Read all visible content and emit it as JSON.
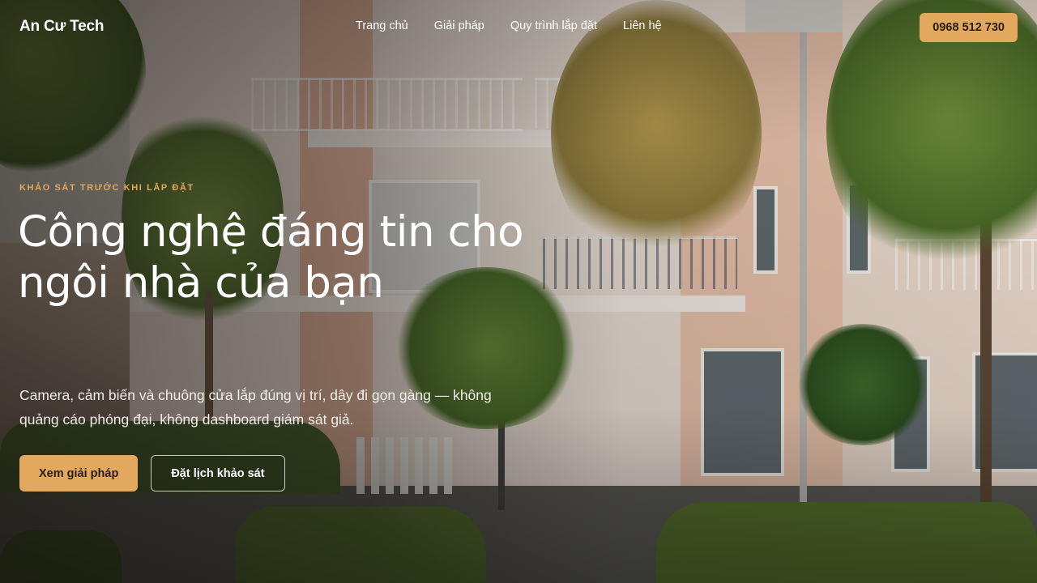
{
  "header": {
    "brand": "An Cư Tech",
    "nav": [
      {
        "label": "Trang chủ"
      },
      {
        "label": "Giải pháp"
      },
      {
        "label": "Quy trình lắp đặt"
      },
      {
        "label": "Liên hệ"
      }
    ],
    "phone": "0968 512 730"
  },
  "hero": {
    "eyebrow": "Khảo sát trước khi lắp đặt",
    "headline": "Công nghệ đáng tin cho ngôi nhà của bạn",
    "subtitle": "Camera, cảm biến và chuông cửa lắp đúng vị trí, dây đi gọn gàng — không quảng cáo phóng đại, không dashboard giám sát giả.",
    "primary_cta": "Xem giải pháp",
    "secondary_cta": "Đặt lịch khảo sát"
  },
  "colors": {
    "accent": "#e1a85e",
    "accent_text": "#2a1c10",
    "eyebrow": "#e3a85c"
  }
}
